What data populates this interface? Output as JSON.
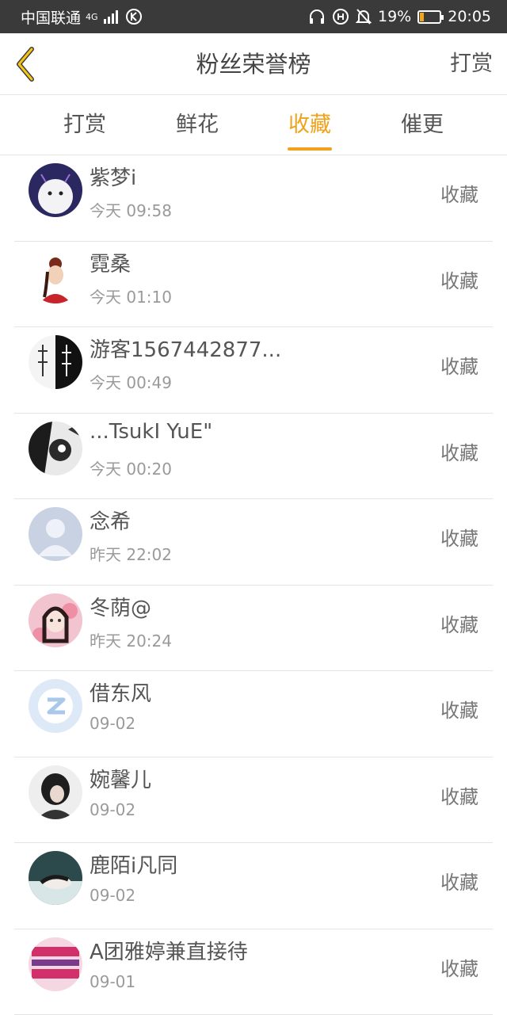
{
  "status_bar": {
    "carrier": "中国联通",
    "network": "4G",
    "battery": "19%",
    "time": "20:05",
    "battery_level": 0.19
  },
  "header": {
    "title": "粉丝荣誉榜",
    "action_label": "打赏"
  },
  "tabs": [
    {
      "label": "打赏",
      "active": false
    },
    {
      "label": "鲜花",
      "active": false
    },
    {
      "label": "收藏",
      "active": true
    },
    {
      "label": "催更",
      "active": false
    }
  ],
  "accent_color": "#f0a21b",
  "list": {
    "items": [
      {
        "name": "紫梦i",
        "time": "今天 09:58",
        "action": "收藏"
      },
      {
        "name": "霓桑",
        "time": "今天 01:10",
        "action": "收藏"
      },
      {
        "name": "游客1567442877...",
        "time": "今天 00:49",
        "action": "收藏"
      },
      {
        "name": "...TsukI YuE\"",
        "time": "今天 00:20",
        "action": "收藏"
      },
      {
        "name": "念希",
        "time": "昨天 22:02",
        "action": "收藏"
      },
      {
        "name": "冬荫@",
        "time": "昨天 20:24",
        "action": "收藏"
      },
      {
        "name": "借东风",
        "time": "09-02",
        "action": "收藏"
      },
      {
        "name": "婉馨儿",
        "time": "09-02",
        "action": "收藏"
      },
      {
        "name": "鹿陌i凡同",
        "time": "09-02",
        "action": "收藏"
      },
      {
        "name": "A团雅婷兼直接待",
        "time": "09-01",
        "action": "收藏"
      }
    ]
  }
}
